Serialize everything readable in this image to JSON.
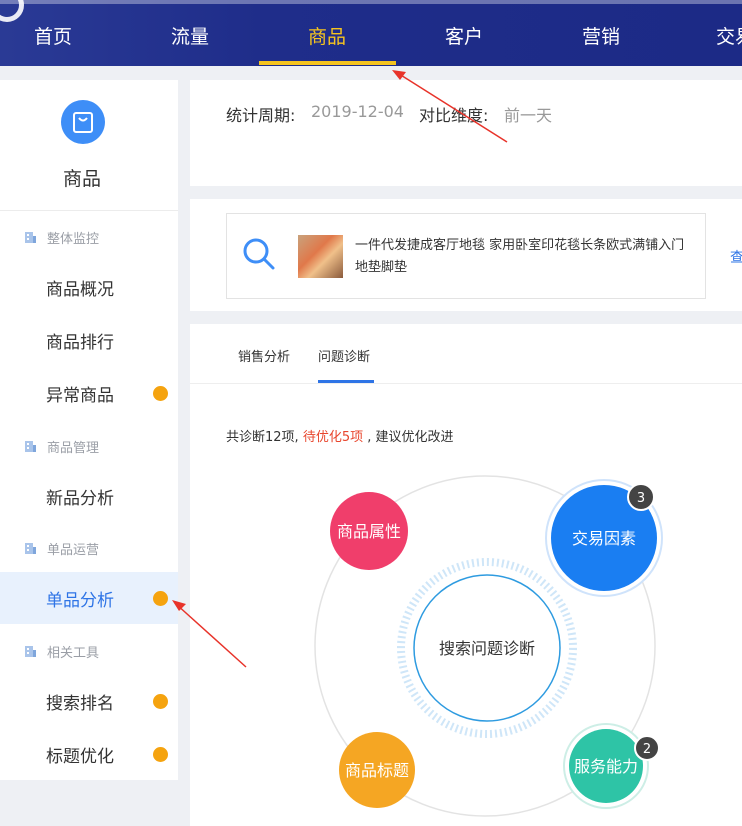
{
  "topnav": {
    "items": [
      {
        "label": "首页"
      },
      {
        "label": "流量"
      },
      {
        "label": "商品"
      },
      {
        "label": "客户"
      },
      {
        "label": "营销"
      },
      {
        "label": "交易"
      }
    ],
    "active_index": 2,
    "active_color": "#f5c41f"
  },
  "sidebar": {
    "title": "商品",
    "groups": [
      {
        "label": "整体监控",
        "items": [
          "商品概况",
          "商品排行",
          "异常商品"
        ]
      },
      {
        "label": "商品管理",
        "items": [
          "新品分析"
        ]
      },
      {
        "label": "单品运营",
        "items": [
          "单品分析"
        ]
      },
      {
        "label": "相关工具",
        "items": [
          "搜索排名",
          "标题优化"
        ]
      }
    ],
    "active_item": "单品分析",
    "dot_color": "#f5a30f"
  },
  "period": {
    "label": "统计周期:",
    "value": "2019-12-04",
    "compare_label": "对比维度:",
    "compare_value": "前一天"
  },
  "product": {
    "title": "一件代发捷成客厅地毯 家用卧室印花毯长条欧式满铺入门地垫脚垫",
    "view_link": "查"
  },
  "tabs": {
    "items": [
      "销售分析",
      "问题诊断"
    ],
    "active": "问题诊断"
  },
  "summary": {
    "prefix": "共诊断12项,",
    "highlight": "待优化5项",
    "suffix": ", 建议优化改进"
  },
  "diagram": {
    "center_label": "搜索问题诊断",
    "nodes": [
      {
        "label": "商品属性",
        "color": "#f03e6b",
        "badge": ""
      },
      {
        "label": "交易因素",
        "color": "#1a7ef2",
        "badge": "3"
      },
      {
        "label": "商品标题",
        "color": "#f5a623",
        "badge": ""
      },
      {
        "label": "服务能力",
        "color": "#2ec4a6",
        "badge": "2"
      }
    ]
  },
  "colors": {
    "accent": "#2e74e6",
    "highlight_red": "#e8452c",
    "nav_bg": "#1f2d8a"
  }
}
